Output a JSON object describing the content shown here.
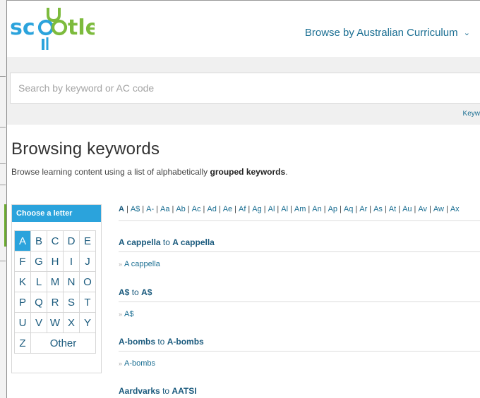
{
  "app": {
    "logo_text": "scootle",
    "brand_colors": {
      "blue": "#2ba3dc",
      "green": "#7dbb3d",
      "link": "#1a6e92",
      "dark_link": "#1a5a7d"
    },
    "browse_menu_label": "Browse by Australian Curriculum",
    "browse_menu_icon": "chevron-down-icon"
  },
  "search": {
    "placeholder": "Search by keyword or AC code",
    "keyword_link": "Keyw"
  },
  "page": {
    "title": "Browsing keywords",
    "subtitle_before": "Browse learning content using a list of alphabetically ",
    "subtitle_bold": "grouped keywords",
    "subtitle_after": "."
  },
  "letter_panel": {
    "title": "Choose a letter",
    "rows": [
      [
        "A",
        "B",
        "C",
        "D",
        "E"
      ],
      [
        "F",
        "G",
        "H",
        "I",
        "J"
      ],
      [
        "K",
        "L",
        "M",
        "N",
        "O"
      ],
      [
        "P",
        "Q",
        "R",
        "S",
        "T"
      ],
      [
        "U",
        "V",
        "W",
        "X",
        "Y"
      ]
    ],
    "last_row": [
      "Z",
      "Other"
    ],
    "active": "A"
  },
  "alpha_bar": {
    "items": [
      "A",
      "A$",
      "A-",
      "Aa",
      "Ab",
      "Ac",
      "Ad",
      "Ae",
      "Af",
      "Ag",
      "Al",
      "Al",
      "Am",
      "An",
      "Ap",
      "Aq",
      "Ar",
      "As",
      "At",
      "Au",
      "Av",
      "Aw",
      "Ax"
    ],
    "current": "A"
  },
  "groups": [
    {
      "from": "A cappella",
      "to": "A cappella",
      "connector": "to",
      "items": [
        "A cappella"
      ]
    },
    {
      "from": "A$",
      "to": "A$",
      "connector": "to",
      "items": [
        "A$"
      ]
    },
    {
      "from": "A-bombs",
      "to": "A-bombs",
      "connector": "to",
      "items": [
        "A-bombs"
      ]
    },
    {
      "from": "Aardvarks",
      "to": "AATSI",
      "connector": "to",
      "items": []
    }
  ]
}
